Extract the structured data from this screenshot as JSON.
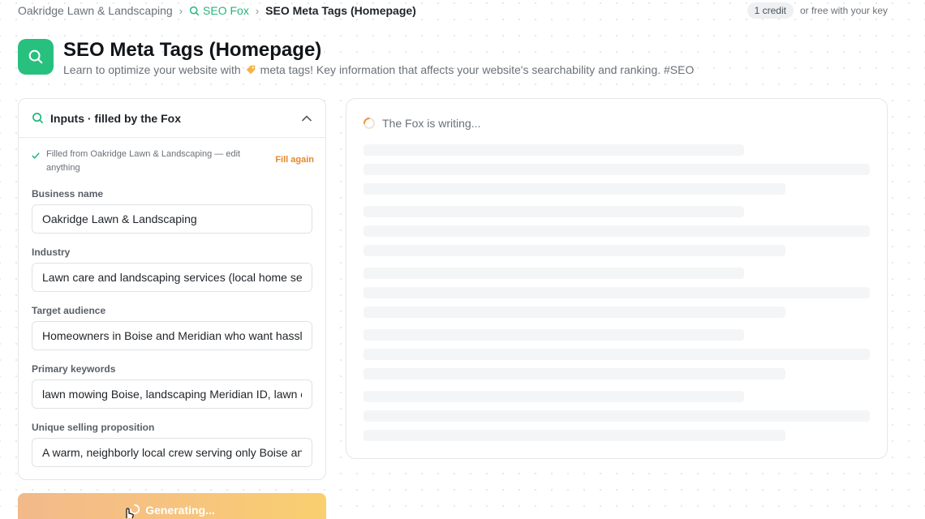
{
  "breadcrumb": {
    "root": "Oakridge Lawn & Landscaping",
    "tool": "SEO Fox",
    "current": "SEO Meta Tags (Homepage)"
  },
  "credits": {
    "badge": "1 credit",
    "note": "or free with your key"
  },
  "page": {
    "title": "SEO Meta Tags (Homepage)",
    "subtitle_before": "Learn to optimize your website with",
    "subtitle_after": "meta tags! Key information that affects your website's searchability and ranking. #SEO"
  },
  "inputs_panel": {
    "header": "Inputs · filled by the Fox",
    "filled_note": "Filled from Oakridge Lawn & Landscaping — edit anything",
    "fill_again": "Fill again",
    "fields": [
      {
        "label": "Business name",
        "value": "Oakridge Lawn & Landscaping"
      },
      {
        "label": "Industry",
        "value": "Lawn care and landscaping services (local home services)"
      },
      {
        "label": "Target audience",
        "value": "Homeowners in Boise and Meridian who want hassle-free yards"
      },
      {
        "label": "Primary keywords",
        "value": "lawn mowing Boise, landscaping Meridian ID, lawn care"
      },
      {
        "label": "Unique selling proposition",
        "value": "A warm, neighborly local crew serving only Boise and Meridian"
      }
    ]
  },
  "generate_button": "Generating...",
  "output_panel": {
    "status": "The Fox is writing..."
  },
  "colors": {
    "brand_green": "#27c07f",
    "link_green": "#22b67a",
    "accent_orange": "#e8862b"
  }
}
